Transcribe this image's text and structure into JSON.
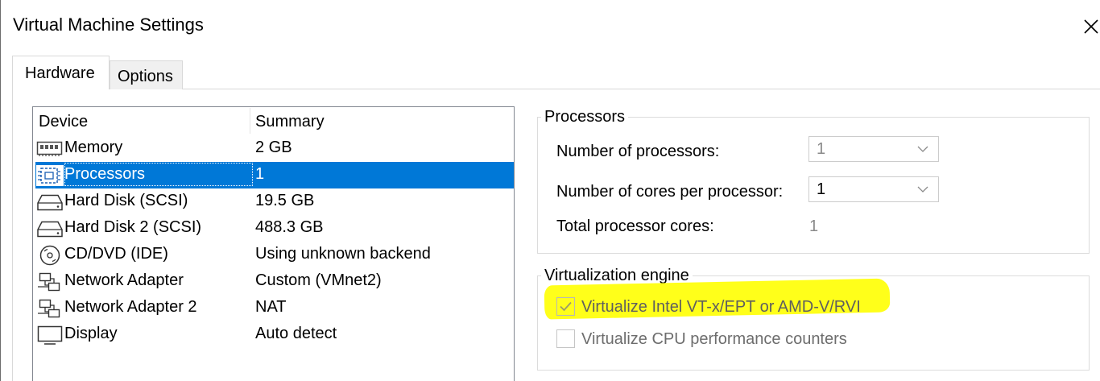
{
  "window": {
    "title": "Virtual Machine Settings"
  },
  "tabs": [
    {
      "label": "Hardware",
      "active": true
    },
    {
      "label": "Options",
      "active": false
    }
  ],
  "device_list": {
    "columns": [
      "Device",
      "Summary"
    ],
    "rows": [
      {
        "device": "Memory",
        "summary": "2 GB",
        "icon": "memory-icon"
      },
      {
        "device": "Processors",
        "summary": "1",
        "icon": "processor-icon",
        "selected": true
      },
      {
        "device": "Hard Disk (SCSI)",
        "summary": "19.5 GB",
        "icon": "hard-disk-icon"
      },
      {
        "device": "Hard Disk 2 (SCSI)",
        "summary": "488.3 GB",
        "icon": "hard-disk-icon"
      },
      {
        "device": "CD/DVD (IDE)",
        "summary": "Using unknown backend",
        "icon": "cd-dvd-icon"
      },
      {
        "device": "Network Adapter",
        "summary": "Custom (VMnet2)",
        "icon": "network-adapter-icon"
      },
      {
        "device": "Network Adapter 2",
        "summary": "NAT",
        "icon": "network-adapter-icon"
      },
      {
        "device": "Display",
        "summary": "Auto detect",
        "icon": "display-icon"
      }
    ]
  },
  "processors": {
    "title": "Processors",
    "num_processors_label": "Number of processors:",
    "num_processors_value": "1",
    "cores_label": "Number of cores per processor:",
    "cores_value": "1",
    "total_label": "Total processor cores:",
    "total_value": "1"
  },
  "virtualization": {
    "title": "Virtualization engine",
    "vtx_label": "Virtualize Intel VT-x/EPT or AMD-V/RVI",
    "vtx_checked": true,
    "cpu_counters_label": "Virtualize CPU performance counters",
    "cpu_counters_checked": false
  },
  "colors": {
    "selection": "#0078d7",
    "highlight": "#ffff1a"
  }
}
